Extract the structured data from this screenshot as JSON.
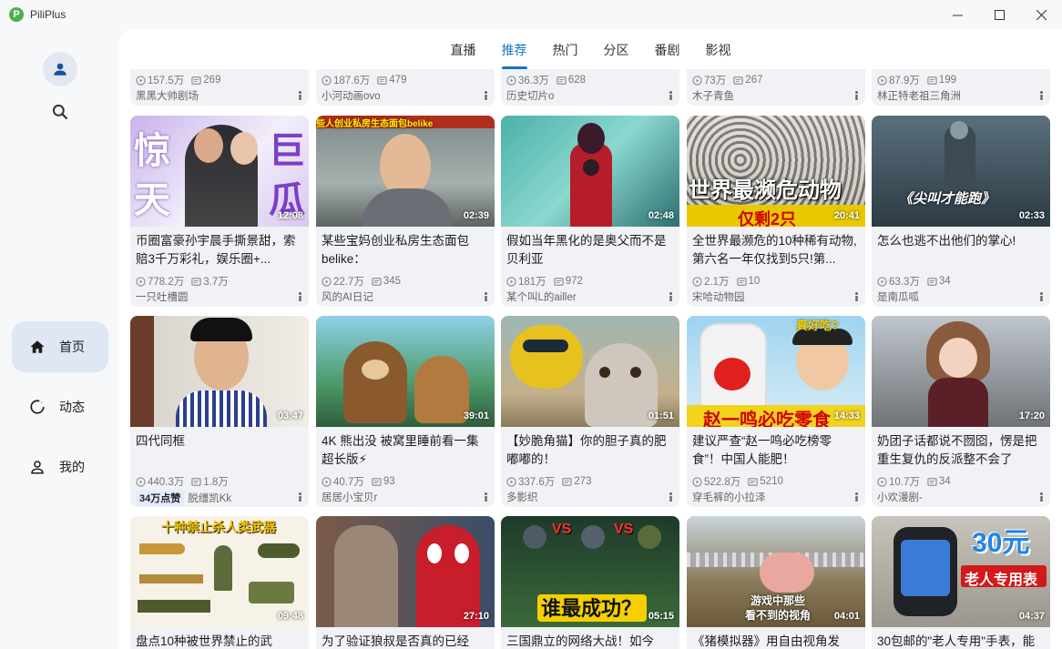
{
  "window": {
    "title": "PiliPlus",
    "logo_letter": "P",
    "controls": {
      "minimize": "—",
      "maximize": "☐",
      "close": "✕"
    }
  },
  "sidebar": {
    "avatar_icon": "person-icon",
    "search_icon": "search-icon",
    "items": [
      {
        "label": "首页",
        "icon": "home-icon",
        "active": true
      },
      {
        "label": "动态",
        "icon": "refresh-icon",
        "active": false
      },
      {
        "label": "我的",
        "icon": "person-icon",
        "active": false
      }
    ]
  },
  "tabs": [
    {
      "label": "直播",
      "active": false
    },
    {
      "label": "推荐",
      "active": true
    },
    {
      "label": "热门",
      "active": false
    },
    {
      "label": "分区",
      "active": false
    },
    {
      "label": "番剧",
      "active": false
    },
    {
      "label": "影视",
      "active": false
    }
  ],
  "partial_row": [
    {
      "views": "157.5万",
      "danmaku": "269",
      "uploader": "黑黑大帅剧场"
    },
    {
      "views": "187.6万",
      "danmaku": "479",
      "uploader": "小河动画ovo"
    },
    {
      "views": "36.3万",
      "danmaku": "628",
      "uploader": "历史切片o"
    },
    {
      "views": "73万",
      "danmaku": "267",
      "uploader": "木子青鱼"
    },
    {
      "views": "87.9万",
      "danmaku": "199",
      "uploader": "林正特老祖三角洲"
    }
  ],
  "videos_row1": [
    {
      "title": "币圈富豪孙宇晨手撕景甜，索赔3千万彩礼，娱乐圈+...",
      "duration": "12:08",
      "views": "778.2万",
      "danmaku": "3.7万",
      "uploader": "一只吐槽圆",
      "caption": "惊 巨 天 瓜"
    },
    {
      "title": "某些宝妈创业私房生态面包belike：",
      "duration": "02:39",
      "views": "22.7万",
      "danmaku": "345",
      "uploader": "风的AI日记",
      "caption": "些人创业私房生态面包belike"
    },
    {
      "title": "假如当年黑化的是奥父而不是贝利亚",
      "duration": "02:48",
      "views": "181万",
      "danmaku": "972",
      "uploader": "某个叫L的ailler",
      "caption": ""
    },
    {
      "title": "全世界最濒危的10种稀有动物,第六名一年仅找到5只!第...",
      "duration": "20:41",
      "views": "2.1万",
      "danmaku": "10",
      "uploader": "宋哈动物园",
      "caption": "世界最濒危动物"
    },
    {
      "title": "怎么也逃不出他们的掌心!",
      "duration": "02:33",
      "views": "63.3万",
      "danmaku": "34",
      "uploader": "是南瓜呱",
      "caption": "《尖叫才能跑》"
    }
  ],
  "videos_row2": [
    {
      "title": "四代同框",
      "duration": "03:47",
      "views": "440.3万",
      "danmaku": "1.8万",
      "uploader": "脱缰凯Kk",
      "badge": "34万点赞",
      "caption": ""
    },
    {
      "title": "4K 熊出没 被窝里睡前看一集 超长版⚡",
      "duration": "39:01",
      "views": "40.7万",
      "danmaku": "93",
      "uploader": "居居小宝贝r",
      "caption": ""
    },
    {
      "title": "【妙脆角猫】你的胆子真的肥嘟嘟的！",
      "duration": "01:51",
      "views": "337.6万",
      "danmaku": "273",
      "uploader": "多影织",
      "caption": ""
    },
    {
      "title": "建议严查“赵一鸣必吃榜零食”！中国人能肥！",
      "duration": "14:33",
      "views": "522.8万",
      "danmaku": "5210",
      "uploader": "穿毛裤的小拉泽",
      "caption": "赵一鸣必吃零食"
    },
    {
      "title": "奶团子话都说不囫囵，愣是把重生复仇的反派整不会了",
      "duration": "17:20",
      "views": "10.7万",
      "danmaku": "34",
      "uploader": "小欢漫剧-",
      "caption": ""
    }
  ],
  "videos_row3": [
    {
      "title": "盘点10种被世界禁止的武",
      "duration": "09:48",
      "caption": "十种禁止杀人类武器"
    },
    {
      "title": "为了验证狼叔是否真的已经",
      "duration": "27:10",
      "caption": ""
    },
    {
      "title": "三国鼎立的网络大战！如今",
      "duration": "05:15",
      "caption": "谁最成功？"
    },
    {
      "title": "《猪模拟器》用自由视角发",
      "duration": "04:01",
      "caption": "游戏中那些看不到的视角"
    },
    {
      "title": "30包邮的\"老人专用\"手表，能",
      "duration": "04:37",
      "caption": "30元 老人专用表"
    }
  ],
  "colors": {
    "accent": "#1a73c8",
    "nav_active_bg": "#dfe6f4",
    "card_bg": "#f0f2f5"
  }
}
